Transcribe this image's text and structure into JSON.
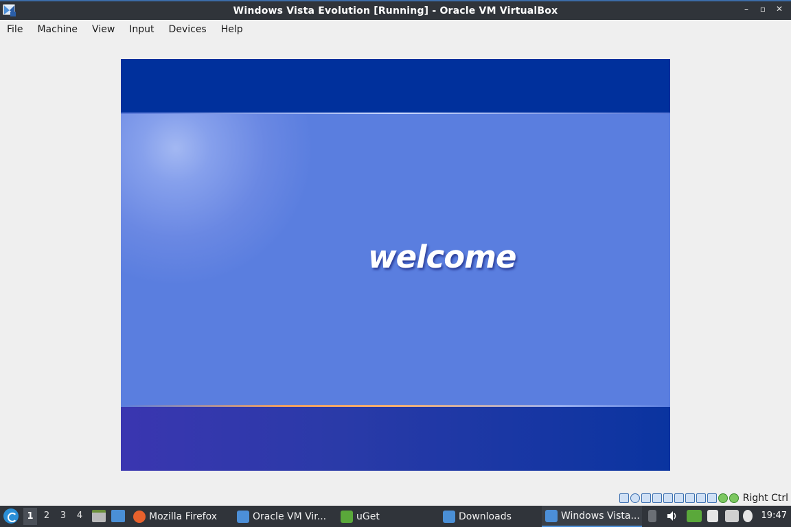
{
  "window": {
    "title": "Windows Vista Evolution [Running] - Oracle VM VirtualBox",
    "controls": [
      "–",
      "▫",
      "✕"
    ]
  },
  "menu": [
    "File",
    "Machine",
    "View",
    "Input",
    "Devices",
    "Help"
  ],
  "vm": {
    "welcome_text": "welcome",
    "colors": {
      "top": "#00309c",
      "middle": "#5a7edf",
      "bottom": "#2a3aa8"
    }
  },
  "status_bar": {
    "icons": [
      "hard-disk-icon",
      "optical-drive-icon",
      "audio-icon",
      "network-icon",
      "usb-icon",
      "shared-folders-icon",
      "display-icon",
      "video-capture-icon",
      "cpu-icon",
      "guest-additions-icon",
      "mouse-integration-icon"
    ],
    "host_key": "Right Ctrl"
  },
  "taskbar": {
    "workspaces": [
      "1",
      "2",
      "3",
      "4"
    ],
    "active_workspace": "1",
    "tasks": [
      {
        "label": "Mozilla Firefox",
        "icon": "firefox-icon",
        "color": "#e8612c"
      },
      {
        "label": "Oracle VM Vir...",
        "icon": "virtualbox-icon",
        "color": "#4c8fd8"
      },
      {
        "label": "uGet",
        "icon": "uget-icon",
        "color": "#5aa83a"
      },
      {
        "label": "Downloads",
        "icon": "folder-icon",
        "color": "#4a8fd6"
      },
      {
        "label": "Windows Vista...",
        "icon": "virtualbox-vm-icon",
        "color": "#4c8fd8"
      }
    ],
    "clock": "19:47"
  }
}
